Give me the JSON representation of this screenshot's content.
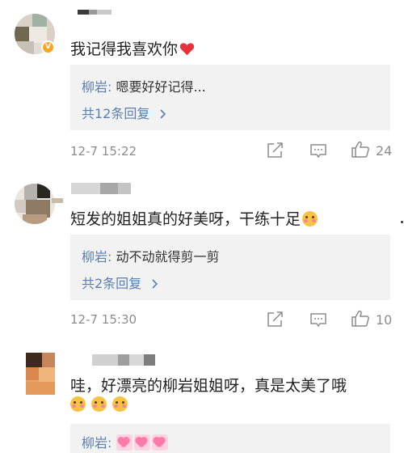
{
  "comments": [
    {
      "text": "我记得我喜欢你",
      "has_verified_badge": true,
      "reply": {
        "author": "柳岩:",
        "text": "嗯要好好记得...",
        "more": "共12条回复"
      },
      "time": "12-7 15:22",
      "likes": "24",
      "trailing_emoji": "heart"
    },
    {
      "text": "短发的姐姐真的好美呀，干练十足",
      "has_verified_badge": false,
      "reply": {
        "author": "柳岩:",
        "text": "动不动就得剪一剪",
        "more": "共2条回复"
      },
      "time": "12-7 15:30",
      "likes": "10",
      "trailing_emoji": "blush-face"
    },
    {
      "text": "哇，好漂亮的柳岩姐姐呀，真是太美了哦",
      "has_verified_badge": false,
      "emoji_row": [
        "blush-face",
        "blush-face",
        "blush-face"
      ],
      "reply": {
        "author": "柳岩:",
        "text": "",
        "emojis": [
          "heart-sticker",
          "heart-sticker",
          "heart-sticker"
        ]
      }
    }
  ],
  "icons": {
    "share": "share-icon",
    "comment": "comment-icon",
    "like": "thumbs-up-icon",
    "chevron": "chevron-right-icon"
  },
  "colors": {
    "reply_author": "#5b7fb0",
    "reply_box": "#f2f2f2",
    "meta": "#8c8c8c",
    "verified": "#f5a623",
    "heart": "#e8323c"
  }
}
